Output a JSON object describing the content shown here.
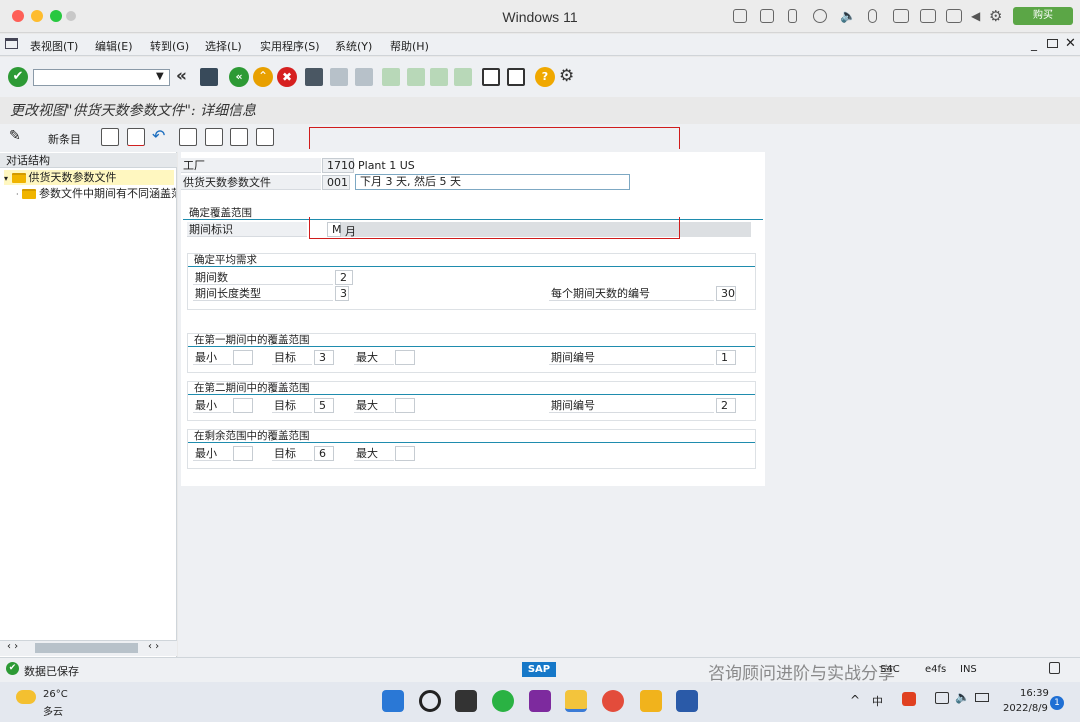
{
  "window": {
    "title": "Windows 11",
    "buy_label": "购买"
  },
  "menu": [
    "表视图(T)",
    "编辑(E)",
    "转到(G)",
    "选择(L)",
    "实用程序(S)",
    "系统(Y)",
    "帮助(H)"
  ],
  "screen_title": "更改视图\"供货天数参数文件\": 详细信息",
  "app_toolbar": {
    "new_entries": "新条目"
  },
  "tree": {
    "header": "对话结构",
    "items": [
      "供货天数参数文件",
      "参数文件中期间有不同涵盖范围"
    ]
  },
  "form": {
    "plant_label": "工厂",
    "plant_code": "1710",
    "plant_name": "Plant 1 US",
    "profile_label": "供货天数参数文件",
    "profile_code": "001",
    "profile_desc": "下月 3 天, 然后 5 天",
    "coverage": {
      "title": "确定覆盖范围",
      "period_ind_label": "期间标识",
      "period_ind_code": "M",
      "period_ind_text": "月"
    },
    "avg": {
      "title": "确定平均需求",
      "num_periods_label": "期间数",
      "num_periods": "2",
      "period_len_label": "期间长度类型",
      "period_len": "3",
      "days_per_period_label": "每个期间天数的编号",
      "days_per_period": "30"
    },
    "first": {
      "title": "在第一期间中的覆盖范围",
      "min_label": "最小",
      "min": "",
      "target_label": "目标",
      "target": "3",
      "max_label": "最大",
      "max": "",
      "period_no_label": "期间编号",
      "period_no": "1"
    },
    "second": {
      "title": "在第二期间中的覆盖范围",
      "min_label": "最小",
      "min": "",
      "target_label": "目标",
      "target": "5",
      "max_label": "最大",
      "max": "",
      "period_no_label": "期间编号",
      "period_no": "2"
    },
    "rest": {
      "title": "在剩余范围中的覆盖范围",
      "min_label": "最小",
      "min": "",
      "target_label": "目标",
      "target": "6",
      "max_label": "最大",
      "max": ""
    }
  },
  "status": {
    "message": "数据已保存",
    "sap_logo": "SAP",
    "right_items": [
      "S4C",
      "e4fs",
      "INS"
    ],
    "watermark": "咨询顾问进阶与实战分享"
  },
  "taskbar": {
    "temp": "26°C",
    "weather": "多云",
    "time": "16:39",
    "date": "2022/8/9",
    "lang": "中",
    "notif": "1"
  }
}
